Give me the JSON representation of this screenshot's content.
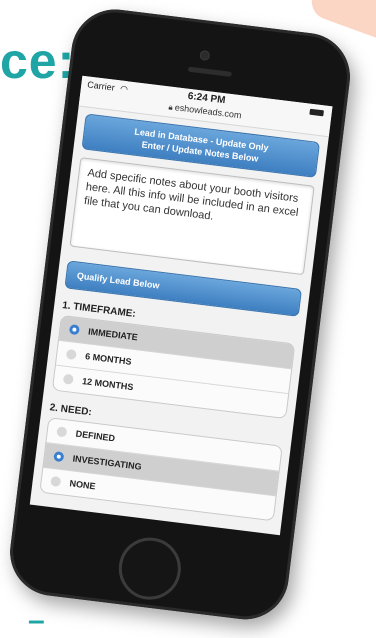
{
  "page": {
    "headline": "ce:",
    "footer_mark": "–"
  },
  "status_bar": {
    "carrier": "Carrier",
    "time": "6:24 PM",
    "url": "eshowleads.com"
  },
  "lead_header": {
    "line1": "Lead in Database - Update Only",
    "line2": "Enter / Update Notes Below"
  },
  "notes": {
    "text": "Add specific notes about your booth visitors here.  All this info will be included in an excel file that you can download."
  },
  "qualify_header": "Qualify Lead Below",
  "timeframe": {
    "label": "1. TIMEFRAME:",
    "options": [
      {
        "label": "IMMEDIATE",
        "selected": true
      },
      {
        "label": "6 MONTHS",
        "selected": false
      },
      {
        "label": "12 MONTHS",
        "selected": false
      }
    ]
  },
  "need": {
    "label": "2. NEED:",
    "options": [
      {
        "label": "DEFINED",
        "selected": false
      },
      {
        "label": "INVESTIGATING",
        "selected": true
      },
      {
        "label": "NONE",
        "selected": false
      }
    ]
  },
  "colors": {
    "accent_teal": "#1fa5a5",
    "header_blue": "#3e7fc1",
    "radio_blue": "#3a7ed0"
  }
}
